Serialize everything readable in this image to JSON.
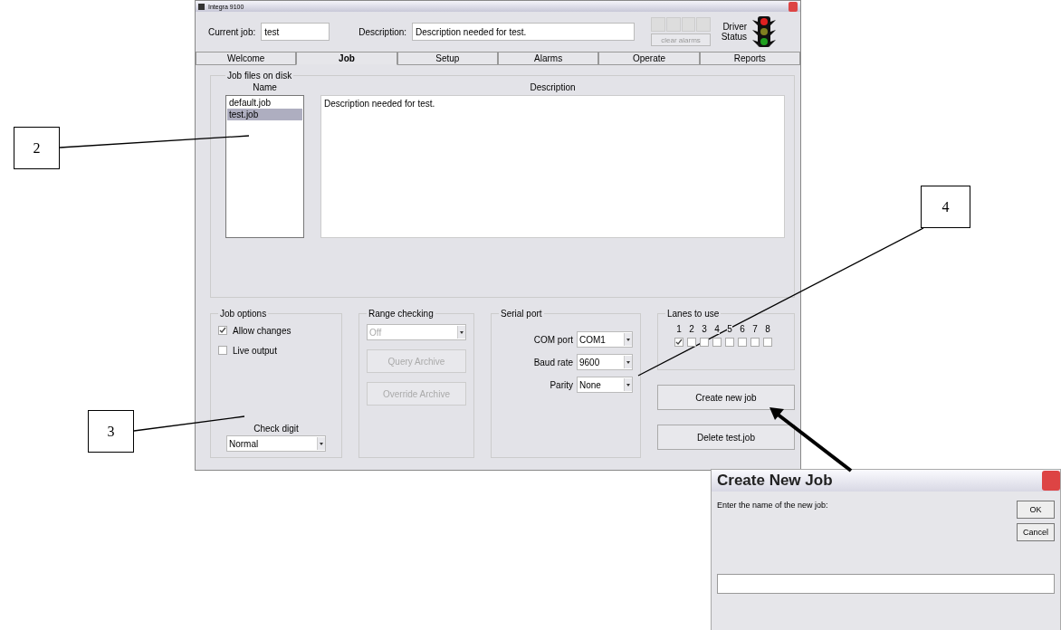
{
  "window": {
    "title": "Integra 9100"
  },
  "header": {
    "current_job_label": "Current job:",
    "current_job": "test",
    "description_label": "Description:",
    "description": "Description needed for test.",
    "clear_alarms": {
      "label": "clear alarms",
      "disabled": true
    },
    "driver_status_label": "Driver Status"
  },
  "tabs": [
    {
      "label": "Welcome",
      "selected": false
    },
    {
      "label": "Job",
      "selected": true
    },
    {
      "label": "Setup",
      "selected": false
    },
    {
      "label": "Alarms",
      "selected": false
    },
    {
      "label": "Operate",
      "selected": false
    },
    {
      "label": "Reports",
      "selected": false
    }
  ],
  "job_files": {
    "title": "Job files on disk",
    "name_header": "Name",
    "description_header": "Description",
    "description": "Description needed for test.",
    "files": [
      {
        "name": "default.job",
        "selected": false
      },
      {
        "name": "test.job",
        "selected": true
      }
    ]
  },
  "job_options": {
    "title": "Job options",
    "options": [
      {
        "label": "Allow changes",
        "checked": true
      },
      {
        "label": "Live output",
        "checked": false
      }
    ],
    "check_digit_label": "Check digit",
    "check_digit": "Normal"
  },
  "range_checking": {
    "title": "Range checking",
    "value": "Off",
    "disabled": true,
    "buttons": [
      {
        "label": "Query Archive",
        "disabled": true
      },
      {
        "label": "Override Archive",
        "disabled": true
      }
    ]
  },
  "serial_port": {
    "title": "Serial port",
    "fields": [
      {
        "label": "COM port",
        "value": "COM1"
      },
      {
        "label": "Baud rate",
        "value": "9600"
      },
      {
        "label": "Parity",
        "value": "None"
      }
    ]
  },
  "lanes": {
    "title": "Lanes to use",
    "lanes": [
      {
        "number": "1",
        "checked": true
      },
      {
        "number": "2",
        "checked": false
      },
      {
        "number": "3",
        "checked": false
      },
      {
        "number": "4",
        "checked": false
      },
      {
        "number": "5",
        "checked": false
      },
      {
        "number": "6",
        "checked": false
      },
      {
        "number": "7",
        "checked": false
      },
      {
        "number": "8",
        "checked": false
      }
    ]
  },
  "buttons": [
    "Create new job",
    "Delete test.job"
  ],
  "dialog": {
    "title": "Create New Job",
    "prompt": "Enter the name of the new job:",
    "buttons": [
      "OK",
      "Cancel"
    ]
  },
  "callouts": [
    {
      "label": "2"
    },
    {
      "label": "3"
    },
    {
      "label": "4"
    }
  ]
}
